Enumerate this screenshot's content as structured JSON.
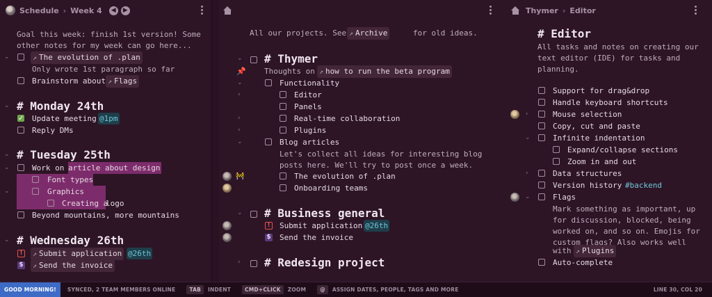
{
  "panel1": {
    "breadcrumb": [
      "Schedule",
      "Week 4"
    ],
    "intro": [
      "Goal this week: finish 1st version! Some",
      "other notes for my week can go here..."
    ],
    "item_evolution": "The evolution of .plan",
    "note_evolution": "Only wrote 1st paragraph so far",
    "item_brainstorm": "Brainstorm about",
    "link_flags": "Flags",
    "h_monday": "# Monday 24th",
    "item_update": "Update meeting",
    "tag_1pm": "@1pm",
    "item_reply": "Reply DMs",
    "h_tuesday": "# Tuesday 25th",
    "item_work_on": "Work on",
    "item_work_hl": "article about design",
    "item_fonttypes": "Font types",
    "item_graphics": "Graphics",
    "item_creating_hl": "Creating a",
    "item_creating_rest": " logo",
    "item_beyond": "Beyond mountains, more mountains",
    "h_wednesday": "# Wednesday 26th",
    "item_submit": "Submit application",
    "tag_26th": "@26th",
    "item_invoice": "Send the invoice"
  },
  "panel2": {
    "intro_pre": "All our projects. See",
    "link_archive": "Archive",
    "intro_post": "for old ideas.",
    "h_thymer": "# Thymer",
    "thoughts_pre": "Thoughts on",
    "link_beta": "how to run the beta program",
    "item_functionality": "Functionality",
    "item_editor": "Editor",
    "item_panels": "Panels",
    "item_realtime": "Real-time collaboration",
    "item_plugins": "Plugins",
    "item_blog": "Blog articles",
    "blog_note": [
      "Let's collect all ideas for interesting blog",
      "posts here. We'll try to post once a week."
    ],
    "item_evolution": "The evolution of .plan",
    "item_onboarding": "Onboarding teams",
    "h_business": "# Business general",
    "item_submit": "Submit application",
    "tag_26th": "@26th",
    "item_invoice": "Send the invoice",
    "h_redesign": "# Redesign project"
  },
  "panel3": {
    "breadcrumb": [
      "Thymer",
      "Editor"
    ],
    "h_editor": "# Editor",
    "intro": [
      "All tasks and notes on creating our",
      "text editor (IDE) for tasks and",
      "planning."
    ],
    "item_dragdrop": "Support for drag&drop",
    "item_keyboard": "Handle keyboard shortcuts",
    "item_mouse": "Mouse selection",
    "item_copy": "Copy, cut and paste",
    "item_indent": "Infinite indentation",
    "item_expand": "Expand/collapse sections",
    "item_zoom": "Zoom in and out",
    "item_datastruct": "Data structures",
    "item_version": "Version history",
    "tag_backend": "#backend",
    "item_flags": "Flags",
    "flags_note": [
      "Mark something as important, up",
      "for discussion, blocked, being",
      "worked on, and so on. Emojis for",
      "custom flags? Also works well"
    ],
    "flags_note_with": "with",
    "link_plugins": "Plugins",
    "item_autocomplete": "Auto-complete"
  },
  "status": {
    "greeting": "GOOD MORNING!",
    "sync": "SYNCED, 2 TEAM MEMBERS ONLINE",
    "kbd_tab": "TAB",
    "lbl_indent": "INDENT",
    "kbd_cmd": "CMD+CLICK",
    "lbl_zoom": "ZOOM",
    "kbd_at": "@",
    "lbl_assign": "ASSIGN DATES, PEOPLE, TAGS AND MORE",
    "position": "LINE 30, COL 20"
  },
  "colors": {
    "background": "#2d1526",
    "highlight": "#7d2c6b",
    "tag": "#6fc6d8",
    "greeting_bg": "#3d6bc6"
  }
}
